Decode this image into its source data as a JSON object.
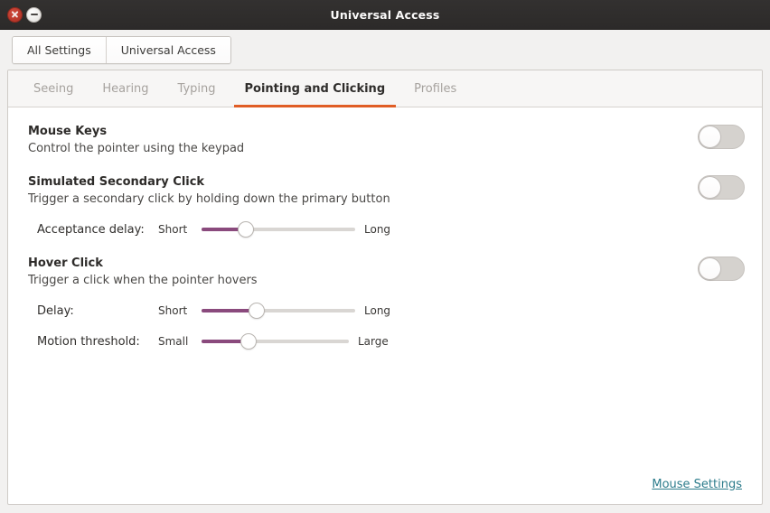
{
  "window": {
    "title": "Universal Access",
    "controls": {
      "close": "close-window",
      "minimize": "minimize-window"
    }
  },
  "toolbar": {
    "buttons": [
      {
        "label": "All Settings"
      },
      {
        "label": "Universal Access"
      }
    ]
  },
  "tabs": [
    {
      "label": "Seeing",
      "active": false
    },
    {
      "label": "Hearing",
      "active": false
    },
    {
      "label": "Typing",
      "active": false
    },
    {
      "label": "Pointing and Clicking",
      "active": true
    },
    {
      "label": "Profiles",
      "active": false
    }
  ],
  "sections": [
    {
      "title": "Mouse Keys",
      "description": "Control the pointer using the keypad",
      "toggle": {
        "state": "off"
      },
      "sliders": []
    },
    {
      "title": "Simulated Secondary Click",
      "description": "Trigger a secondary click by holding down the primary button",
      "toggle": {
        "state": "off"
      },
      "sliders": [
        {
          "label": "Acceptance delay:",
          "min_label": "Short",
          "max_label": "Long",
          "value_percent": 29
        }
      ]
    },
    {
      "title": "Hover Click",
      "description": "Trigger a click when the pointer hovers",
      "toggle": {
        "state": "off"
      },
      "sliders": [
        {
          "label": "Delay:",
          "min_label": "Short",
          "max_label": "Long",
          "value_percent": 36
        },
        {
          "label": "Motion threshold:",
          "min_label": "Small",
          "max_label": "Large",
          "value_percent": 32
        }
      ]
    }
  ],
  "footer": {
    "link_label": "Mouse Settings"
  },
  "colors": {
    "titlebar": "#2e2c2b",
    "accent_tab": "#e05d25",
    "slider_fill": "#8a4a7d",
    "link": "#2d7c8c",
    "close_button": "#b63528"
  }
}
